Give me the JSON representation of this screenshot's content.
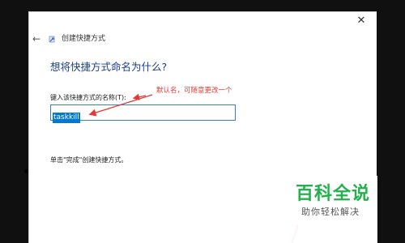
{
  "window": {
    "close_glyph": "✕",
    "back_glyph": "←",
    "title": "创建快捷方式"
  },
  "main": {
    "heading": "想将快捷方式命名为什么?",
    "field_label": "键入该快捷方式的名称(T):",
    "name_value": "taskkill",
    "finish_hint": "单击\"完成\"创建快捷方式。"
  },
  "annotation": {
    "text": "默认名，可随意更改一个",
    "color": "#e53935"
  },
  "watermark": {
    "title": "百科全说",
    "subtitle": "助你轻松解决",
    "color": "#22b14c"
  },
  "colors": {
    "heading": "#1a3e8a",
    "selection": "#0078d7",
    "input_border": "#3a7bd5"
  },
  "icons": {
    "close": "close-icon",
    "back": "back-arrow-icon",
    "wizard": "shortcut-wizard-icon"
  }
}
